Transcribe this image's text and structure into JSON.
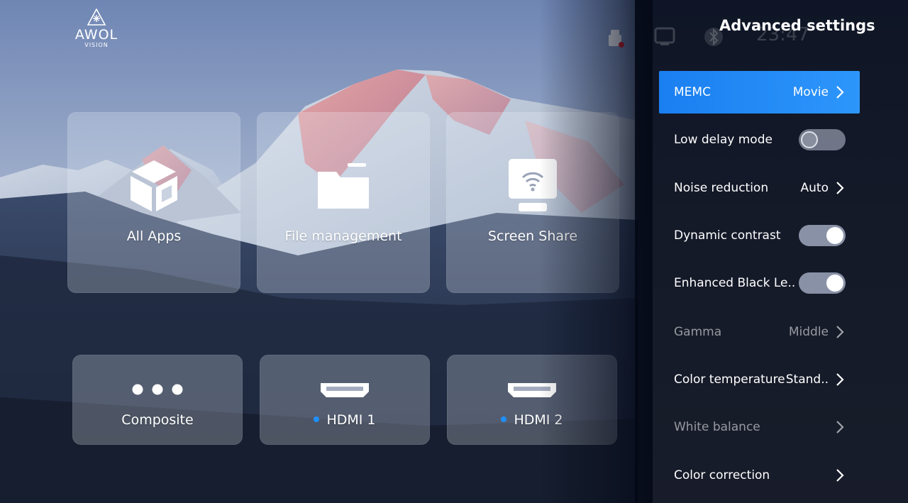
{
  "logo": {
    "word": "AWOL",
    "sub": "VISION"
  },
  "tiles": [
    {
      "label": "All Apps",
      "icon": "cube-icon"
    },
    {
      "label": "File management",
      "icon": "folder-icon"
    },
    {
      "label": "Screen Share",
      "icon": "screen-share-icon"
    },
    {
      "label": "Composite",
      "icon": "composite-dots-icon"
    },
    {
      "label": "HDMI 1",
      "icon": "hdmi-icon",
      "active": true
    },
    {
      "label": "HDMI 2",
      "icon": "hdmi-icon",
      "active": true
    }
  ],
  "status": {
    "clock": "23:47"
  },
  "settings": {
    "title": "Advanced settings",
    "rows": [
      {
        "label": "MEMC",
        "value": "Movie",
        "kind": "select",
        "focused": true
      },
      {
        "label": "Low delay mode",
        "kind": "toggle",
        "on": false
      },
      {
        "label": "Noise reduction",
        "value": "Auto",
        "kind": "select"
      },
      {
        "label": "Dynamic contrast",
        "kind": "toggle",
        "on": true
      },
      {
        "label": "Enhanced Black Le..",
        "kind": "toggle",
        "on": true
      },
      {
        "label": "Gamma",
        "value": "Middle",
        "kind": "select",
        "dim": true
      },
      {
        "label": "Color temperature",
        "value": "Stand..",
        "kind": "select"
      },
      {
        "label": "White balance",
        "kind": "link",
        "dim": true
      },
      {
        "label": "Color correction",
        "kind": "link"
      }
    ]
  },
  "colors": {
    "accent": "#1a7ff0",
    "active_dot": "#1e90ff",
    "panel": "#040916"
  }
}
